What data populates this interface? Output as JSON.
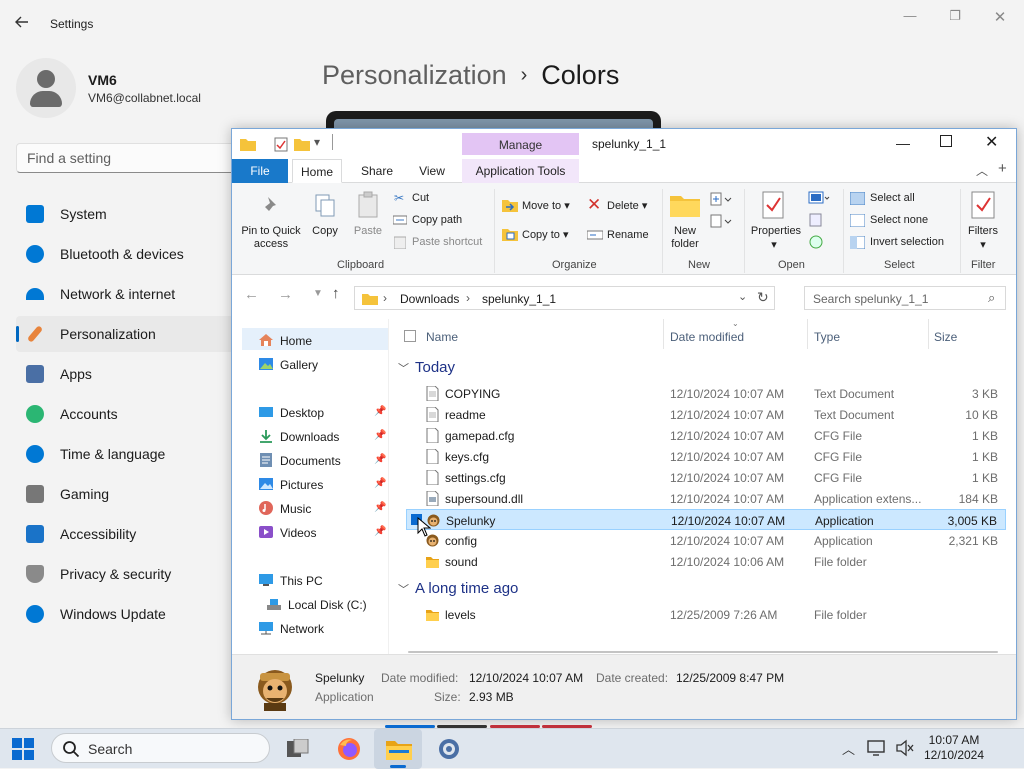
{
  "settings": {
    "title": "Settings",
    "user": {
      "name": "VM6",
      "email": "VM6@collabnet.local"
    },
    "search_placeholder": "Find a setting",
    "breadcrumb": {
      "parent": "Personalization",
      "current": "Colors"
    },
    "nav": [
      {
        "label": "System",
        "icon": "monitor-icon",
        "color": "#0078d4"
      },
      {
        "label": "Bluetooth & devices",
        "icon": "bluetooth-icon",
        "color": "#0078d4"
      },
      {
        "label": "Network & internet",
        "icon": "wifi-icon",
        "color": "#0078d4"
      },
      {
        "label": "Personalization",
        "icon": "paintbrush-icon",
        "color": "#e8843c",
        "selected": true
      },
      {
        "label": "Apps",
        "icon": "apps-icon",
        "color": "#4a6fa5"
      },
      {
        "label": "Accounts",
        "icon": "person-icon",
        "color": "#2bb673"
      },
      {
        "label": "Time & language",
        "icon": "clock-globe-icon",
        "color": "#0078d4"
      },
      {
        "label": "Gaming",
        "icon": "gamepad-icon",
        "color": "#777"
      },
      {
        "label": "Accessibility",
        "icon": "accessibility-icon",
        "color": "#1a73c8"
      },
      {
        "label": "Privacy & security",
        "icon": "shield-icon",
        "color": "#8a8a8a"
      },
      {
        "label": "Windows Update",
        "icon": "update-icon",
        "color": "#0078d4"
      }
    ]
  },
  "explorer": {
    "title": "spelunky_1_1",
    "context_tab_group": "Manage",
    "tabs": {
      "file": "File",
      "home": "Home",
      "share": "Share",
      "view": "View",
      "app_tools": "Application Tools"
    },
    "ribbon": {
      "pin": "Pin to Quick access",
      "copy": "Copy",
      "paste": "Paste",
      "cut": "Cut",
      "copy_path": "Copy path",
      "paste_shortcut": "Paste shortcut",
      "clipboard": "Clipboard",
      "move_to": "Move to",
      "copy_to": "Copy to",
      "delete": "Delete",
      "rename": "Rename",
      "organize": "Organize",
      "new_folder": "New folder",
      "new": "New",
      "properties": "Properties",
      "open": "Open",
      "select_all": "Select all",
      "select_none": "Select none",
      "invert_selection": "Invert selection",
      "select": "Select",
      "filters": "Filters",
      "filter": "Filter"
    },
    "address": {
      "seg1": "Downloads",
      "seg2": "spelunky_1_1",
      "search_placeholder": "Search spelunky_1_1"
    },
    "tree": {
      "home": "Home",
      "gallery": "Gallery",
      "desktop": "Desktop",
      "downloads": "Downloads",
      "documents": "Documents",
      "pictures": "Pictures",
      "music": "Music",
      "videos": "Videos",
      "this_pc": "This PC",
      "local_disk": "Local Disk (C:)",
      "network": "Network"
    },
    "columns": {
      "name": "Name",
      "date": "Date modified",
      "type": "Type",
      "size": "Size"
    },
    "groups": {
      "today": "Today",
      "long_ago": "A long time ago"
    },
    "files": [
      {
        "name": "COPYING",
        "date": "12/10/2024 10:07 AM",
        "type": "Text Document",
        "size": "3 KB",
        "icon": "text-file-icon"
      },
      {
        "name": "readme",
        "date": "12/10/2024 10:07 AM",
        "type": "Text Document",
        "size": "10 KB",
        "icon": "text-file-icon"
      },
      {
        "name": "gamepad.cfg",
        "date": "12/10/2024 10:07 AM",
        "type": "CFG File",
        "size": "1 KB",
        "icon": "file-icon"
      },
      {
        "name": "keys.cfg",
        "date": "12/10/2024 10:07 AM",
        "type": "CFG File",
        "size": "1 KB",
        "icon": "file-icon"
      },
      {
        "name": "settings.cfg",
        "date": "12/10/2024 10:07 AM",
        "type": "CFG File",
        "size": "1 KB",
        "icon": "file-icon"
      },
      {
        "name": "supersound.dll",
        "date": "12/10/2024 10:07 AM",
        "type": "Application extens...",
        "size": "184 KB",
        "icon": "dll-file-icon"
      },
      {
        "name": "Spelunky",
        "date": "12/10/2024 10:07 AM",
        "type": "Application",
        "size": "3,005 KB",
        "icon": "spelunky-app-icon",
        "selected": true
      },
      {
        "name": "config",
        "date": "12/10/2024 10:07 AM",
        "type": "Application",
        "size": "2,321 KB",
        "icon": "config-app-icon"
      },
      {
        "name": "sound",
        "date": "12/10/2024 10:06 AM",
        "type": "File folder",
        "size": "",
        "icon": "folder-icon"
      }
    ],
    "old_files": [
      {
        "name": "levels",
        "date": "12/25/2009 7:26 AM",
        "type": "File folder",
        "size": "",
        "icon": "folder-icon"
      }
    ],
    "details": {
      "name": "Spelunky",
      "kind": "Application",
      "modified_label": "Date modified:",
      "modified": "12/10/2024 10:07 AM",
      "created_label": "Date created:",
      "created": "12/25/2009 8:47 PM",
      "size_label": "Size:",
      "size": "2.93 MB"
    }
  },
  "taskbar": {
    "search": "Search",
    "time": "10:07 AM",
    "date": "12/10/2024"
  }
}
